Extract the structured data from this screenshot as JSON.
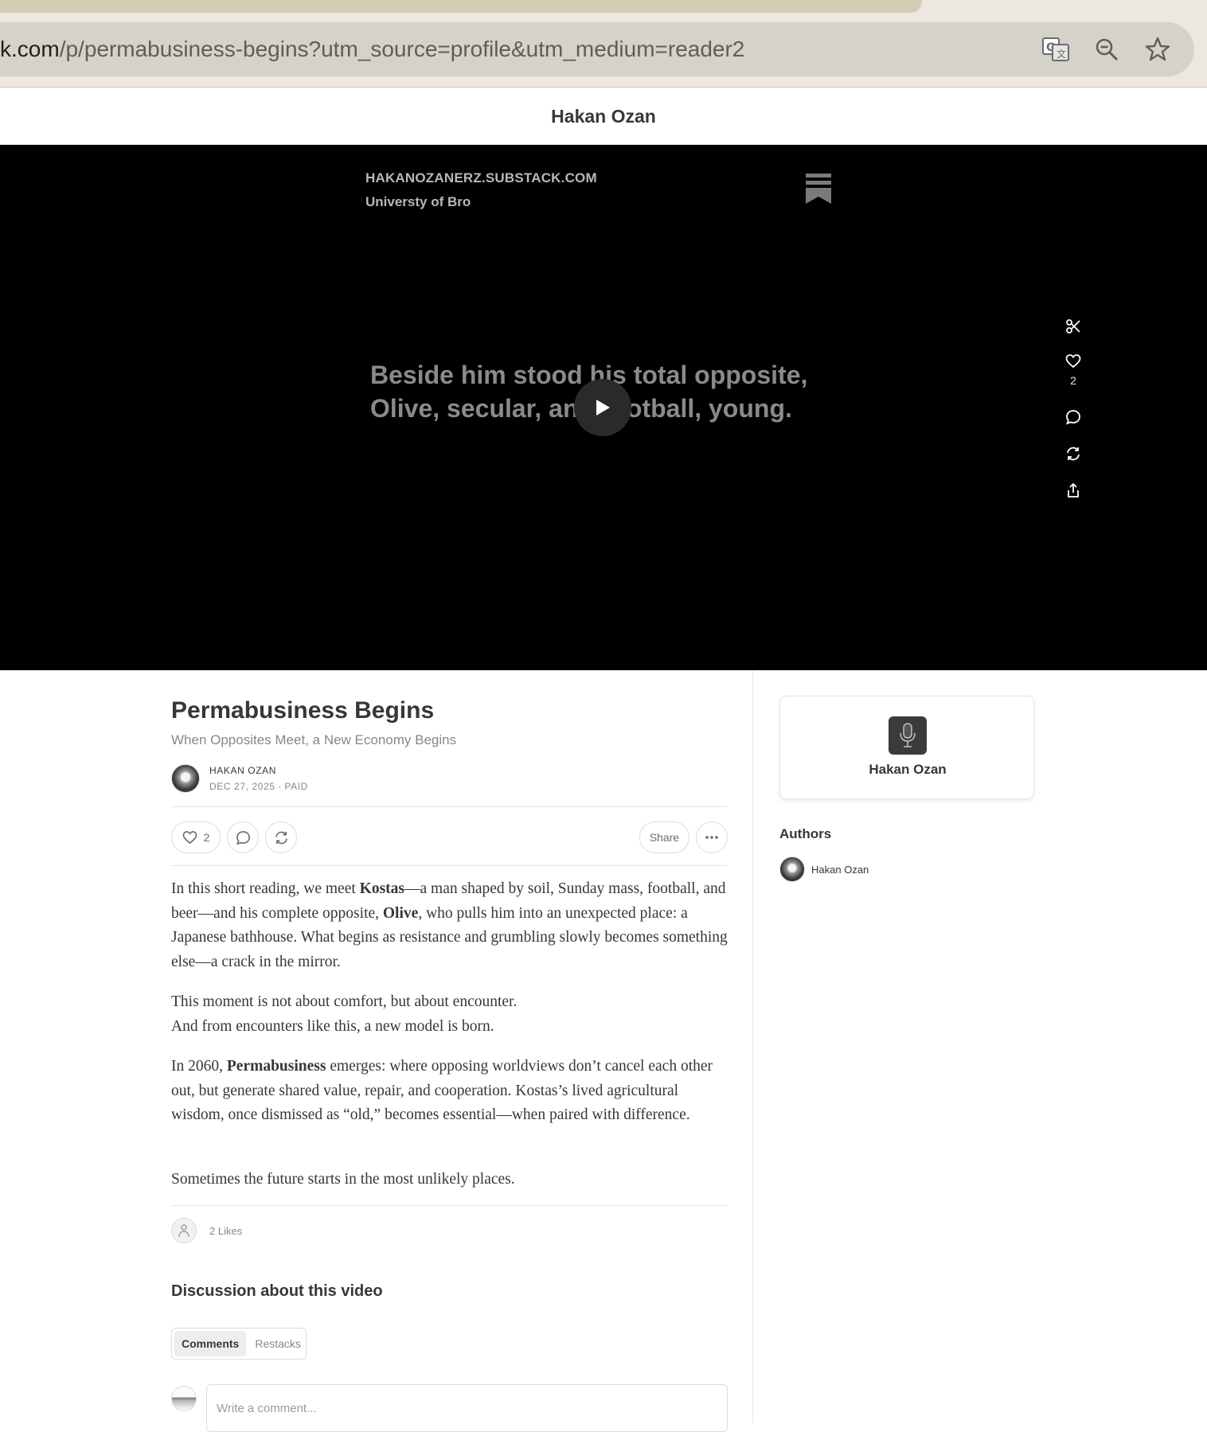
{
  "browser": {
    "url_host": "k.com",
    "url_path": "/p/permabusiness-begins?utm_source=profile&utm_medium=reader2",
    "icons": [
      "translate-icon",
      "zoom-icon",
      "bookmark-star-icon"
    ]
  },
  "site": {
    "title": "Hakan Ozan"
  },
  "video": {
    "publication_domain": "HAKANOZANERZ.SUBSTACK.COM",
    "publication_name": "Universty of Bro",
    "caption": "Beside him stood his total opposite, Olive, secular, anti-football, young.",
    "like_count": "2"
  },
  "post": {
    "title": "Permabusiness Begins",
    "subtitle": "When Opposites Meet, a New Economy Begins",
    "author": "HAKAN OZAN",
    "date": "DEC 27, 2025",
    "separator": "∙",
    "access": "PAID",
    "like_count": "2",
    "share_label": "Share",
    "paragraphs": {
      "p1_a": "In this short reading, we meet ",
      "p1_b": "Kostas",
      "p1_c": "—a man shaped by soil, Sunday mass, football, and beer—and his complete opposite, ",
      "p1_d": "Olive",
      "p1_e": ", who pulls him into an unexpected place: a Japanese bathhouse. What begins as resistance and grumbling slowly becomes something else—a crack in the mirror.",
      "p2_a": "This moment is not about comfort, but about encounter.",
      "p2_b": "And from encounters like this, a new model is born.",
      "p3_a": "In 2060, ",
      "p3_b": "Permabusiness",
      "p3_c": " emerges: where opposing worldviews don’t cancel each other out, but generate shared value, repair, and cooperation. Kostas’s lived agricultural wisdom, once dismissed as “old,” becomes essential—when paired with difference.",
      "p4": "Sometimes the future starts in the most unlikely places."
    },
    "likes_summary": "2 Likes"
  },
  "discussion": {
    "title": "Discussion about this video",
    "tabs": [
      "Comments",
      "Restacks"
    ],
    "comment_placeholder": "Write a comment..."
  },
  "sidebar": {
    "publication_name": "Hakan Ozan",
    "authors_heading": "Authors",
    "authors": [
      {
        "name": "Hakan Ozan"
      }
    ]
  }
}
